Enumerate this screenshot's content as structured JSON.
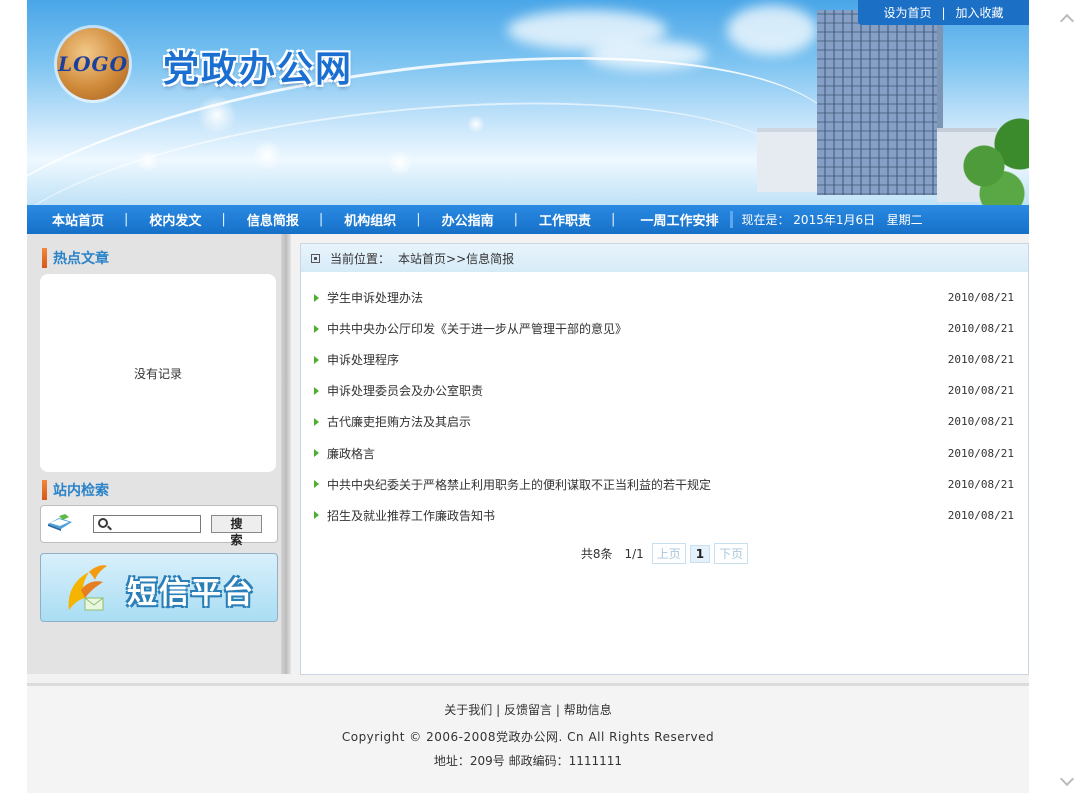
{
  "header": {
    "logo_text": "LOGO",
    "site_title": "党政办公网",
    "top_links": [
      "设为首页",
      "加入收藏"
    ],
    "top_links_sep": "|"
  },
  "nav": {
    "items": [
      "本站首页",
      "校内发文",
      "信息简报",
      "机构组织",
      "办公指南",
      "工作职责",
      "一周工作安排"
    ],
    "sep": "|",
    "date_label": "现在是：",
    "date_value": "2015年1月6日",
    "weekday": "星期二"
  },
  "sidebar": {
    "hot_title": "热点文章",
    "hot_empty": "没有记录",
    "search_title": "站内检索",
    "search_value": "",
    "search_button": "搜 索",
    "sms_text": "短信平台"
  },
  "main": {
    "crumb_label": "当前位置：",
    "crumb_path": "本站首页>>信息简报",
    "articles": [
      {
        "title": "学生申诉处理办法",
        "date": "2010/08/21"
      },
      {
        "title": "中共中央办公厅印发《关于进一步从严管理干部的意见》",
        "date": "2010/08/21"
      },
      {
        "title": "申诉处理程序",
        "date": "2010/08/21"
      },
      {
        "title": "申诉处理委员会及办公室职责",
        "date": "2010/08/21"
      },
      {
        "title": "古代廉吏拒贿方法及其启示",
        "date": "2010/08/21"
      },
      {
        "title": "廉政格言",
        "date": "2010/08/21"
      },
      {
        "title": "中共中央纪委关于严格禁止利用职务上的便利谋取不正当利益的若干规定",
        "date": "2010/08/21"
      },
      {
        "title": "招生及就业推荐工作廉政告知书",
        "date": "2010/08/21"
      }
    ],
    "pager": {
      "total": "共8条",
      "page_info": "1/1",
      "prev": "上页",
      "current": "1",
      "next": "下页"
    }
  },
  "footer": {
    "links": [
      "关于我们",
      "反馈留言",
      "帮助信息"
    ],
    "sep": "|",
    "copyright": "Copyright © 2006-2008党政办公网. Cn All Rights Reserved",
    "address": "地址：209号 邮政编码：1111111"
  },
  "colors": {
    "nav_blue": "#1670c8",
    "title_blue": "#2a83c9",
    "accent_orange": "#e06a24",
    "arrow_green": "#4caf2e"
  }
}
